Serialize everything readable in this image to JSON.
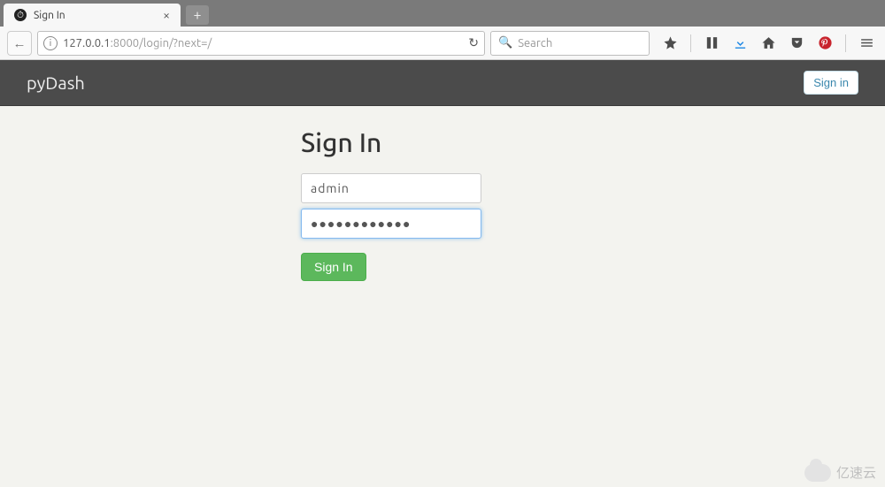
{
  "browser": {
    "tab_title": "Sign In",
    "url_host": "127.0.0.1",
    "url_port_path": ":8000/login/?next=/",
    "search_placeholder": "Search"
  },
  "navbar": {
    "brand": "pyDash",
    "signin_label": "Sign in"
  },
  "form": {
    "heading": "Sign In",
    "username_value": "admin",
    "password_value": "●●●●●●●●●●●●",
    "submit_label": "Sign In"
  },
  "watermark": "亿速云"
}
